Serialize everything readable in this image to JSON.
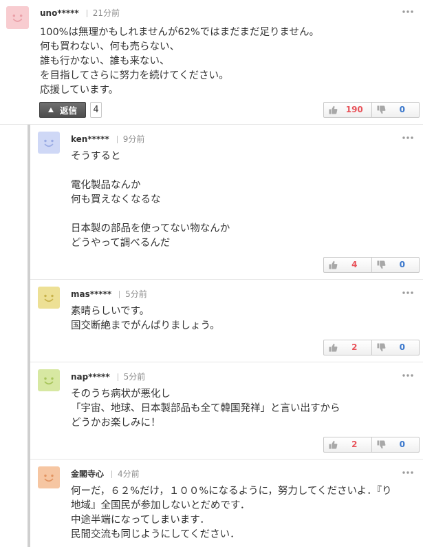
{
  "colors": {
    "like": "#e8535a",
    "dislike": "#3a77cc",
    "reply_button": "#585858",
    "thread_bar": "#cfcfcf"
  },
  "icons": {
    "menu": "more-dots-icon",
    "avatar": "smiley-face-icon",
    "reply": "triangle-up-icon",
    "like": "thumbs-up-icon",
    "dislike": "thumbs-down-icon"
  },
  "comment": {
    "avatar": {
      "bg": "#f8ccd0",
      "face": "#eaa0a8"
    },
    "user": "uno*****",
    "time": "21分前",
    "paragraphs": [
      [
        "100%は無理かもしれませんが62%ではまだまだ足りません。",
        "何も買わない、何も売らない、",
        "誰も行かない、誰も来ない、",
        "を目指してさらに努力を続けてください。",
        "応援しています。"
      ]
    ],
    "reply_label": "返信",
    "reply_count": "4",
    "likes": "190",
    "dislikes": "0"
  },
  "replies": [
    {
      "avatar": {
        "bg": "#cfd8f6",
        "face": "#9aabe4"
      },
      "user": "ken*****",
      "time": "9分前",
      "paragraphs": [
        [
          "そうすると"
        ],
        [
          "電化製品なんか",
          "何も買えなくなるな"
        ],
        [
          "日本製の部品を使ってない物なんか",
          "どうやって調べるんだ"
        ]
      ],
      "likes": "4",
      "dislikes": "0"
    },
    {
      "avatar": {
        "bg": "#ede095",
        "face": "#c8b24b"
      },
      "user": "mas*****",
      "time": "5分前",
      "paragraphs": [
        [
          "素晴らしいです。",
          "国交断絶までがんばりましょう。"
        ]
      ],
      "likes": "2",
      "dislikes": "0"
    },
    {
      "avatar": {
        "bg": "#d7e8a2",
        "face": "#a6c459"
      },
      "user": "nap*****",
      "time": "5分前",
      "paragraphs": [
        [
          "そのうち病状が悪化し",
          "「宇宙、地球、日本製部品も全て韓国発祥」と言い出すから",
          "どうかお楽しみに！"
        ]
      ],
      "likes": "2",
      "dislikes": "0"
    },
    {
      "avatar": {
        "bg": "#f6c6a2",
        "face": "#e29461"
      },
      "user": "金閣寺心",
      "time": "4分前",
      "paragraphs": [
        [
          "何ーだ，６２%だけ，１００%になるように，努力してくださいよ．『り",
          "地域』全国民が参加しないとだめです．",
          "中途半端になってしまいます．",
          "民間交流も同じようにしてください．"
        ]
      ]
    }
  ]
}
